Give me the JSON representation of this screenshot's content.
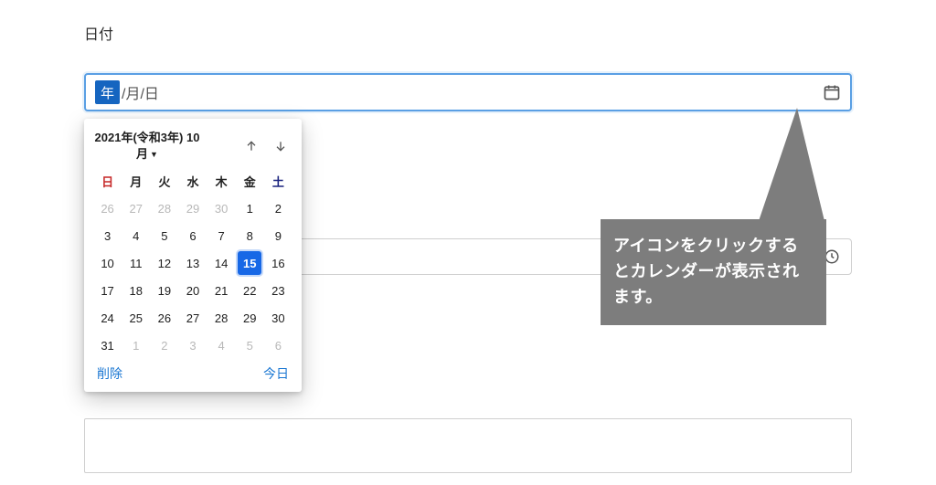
{
  "label": "日付",
  "date_input": {
    "year_placeholder": "年",
    "rest_placeholder": "/月/日"
  },
  "calendar": {
    "title_line1": "2021年(令和3年) 10",
    "title_line2": "月",
    "dow": [
      "日",
      "月",
      "火",
      "水",
      "木",
      "金",
      "土"
    ],
    "weeks": [
      [
        {
          "n": "26",
          "other": true
        },
        {
          "n": "27",
          "other": true
        },
        {
          "n": "28",
          "other": true
        },
        {
          "n": "29",
          "other": true
        },
        {
          "n": "30",
          "other": true
        },
        {
          "n": "1"
        },
        {
          "n": "2"
        }
      ],
      [
        {
          "n": "3"
        },
        {
          "n": "4"
        },
        {
          "n": "5"
        },
        {
          "n": "6"
        },
        {
          "n": "7"
        },
        {
          "n": "8"
        },
        {
          "n": "9"
        }
      ],
      [
        {
          "n": "10"
        },
        {
          "n": "11"
        },
        {
          "n": "12"
        },
        {
          "n": "13"
        },
        {
          "n": "14"
        },
        {
          "n": "15",
          "selected": true
        },
        {
          "n": "16"
        }
      ],
      [
        {
          "n": "17"
        },
        {
          "n": "18"
        },
        {
          "n": "19"
        },
        {
          "n": "20"
        },
        {
          "n": "21"
        },
        {
          "n": "22"
        },
        {
          "n": "23"
        }
      ],
      [
        {
          "n": "24"
        },
        {
          "n": "25"
        },
        {
          "n": "26"
        },
        {
          "n": "27"
        },
        {
          "n": "28"
        },
        {
          "n": "29"
        },
        {
          "n": "30"
        }
      ],
      [
        {
          "n": "31"
        },
        {
          "n": "1",
          "other": true
        },
        {
          "n": "2",
          "other": true
        },
        {
          "n": "3",
          "other": true
        },
        {
          "n": "4",
          "other": true
        },
        {
          "n": "5",
          "other": true
        },
        {
          "n": "6",
          "other": true
        }
      ]
    ],
    "clear_label": "削除",
    "today_label": "今日"
  },
  "callout_text": "アイコンをクリックするとカレンダーが表示されます。"
}
